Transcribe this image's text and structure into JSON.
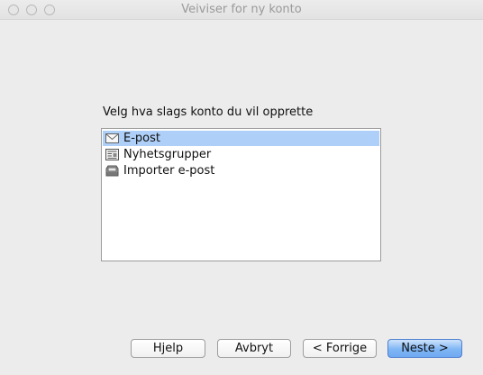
{
  "window": {
    "title": "Veiviser for ny konto"
  },
  "prompt": "Velg hva slags konto du vil opprette",
  "accounts": [
    {
      "label": "E-post",
      "icon": "envelope-icon",
      "selected": true
    },
    {
      "label": "Nyhetsgrupper",
      "icon": "newsgroup-icon",
      "selected": false
    },
    {
      "label": "Importer e-post",
      "icon": "inbox-tray-icon",
      "selected": false
    }
  ],
  "buttons": {
    "help": "Hjelp",
    "cancel": "Avbryt",
    "back": "< Forrige",
    "next": "Neste >"
  },
  "colors": {
    "selection": "#aecff7",
    "default_button": "#7fb6f5"
  }
}
